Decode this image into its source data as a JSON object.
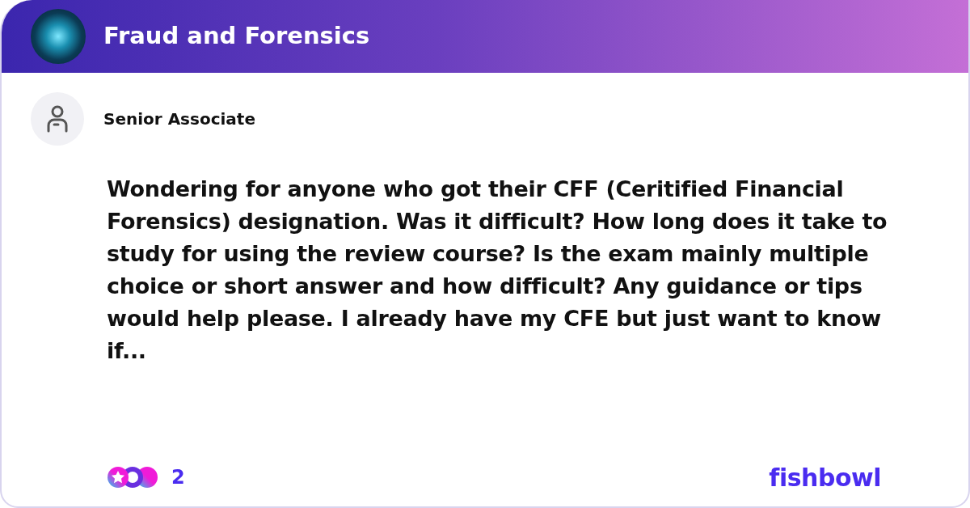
{
  "header": {
    "title": "Fraud and Forensics"
  },
  "post": {
    "author": "Senior Associate",
    "body": "Wondering for anyone who got their CFF (Ceritified Financial Forensics) designation. Was it difficult? How long does it take to study for using the review course? Is the exam mainly multiple choice or short answer and how difficult? Any guidance or tips would help please. I already have my CFE but just want to know if..."
  },
  "reactions": {
    "count": "2"
  },
  "brand": "fishbowl"
}
